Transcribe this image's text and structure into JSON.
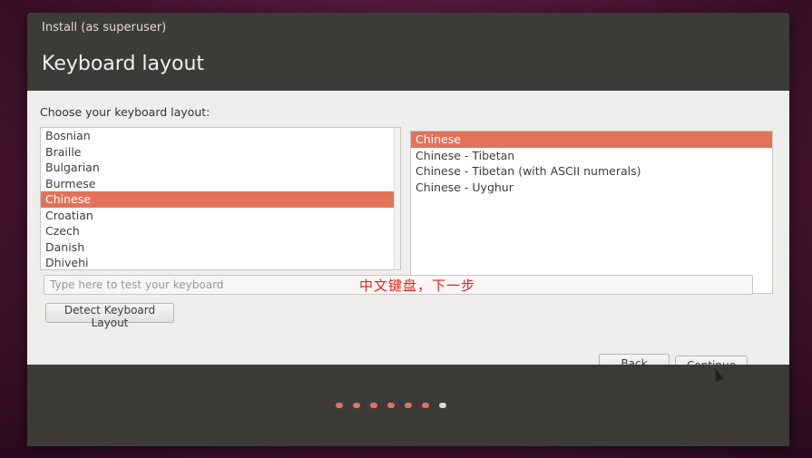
{
  "window": {
    "title": "Install (as superuser)",
    "heading": "Keyboard layout"
  },
  "main": {
    "prompt": "Choose your keyboard layout:",
    "layouts": [
      {
        "label": "Bosnian",
        "selected": false
      },
      {
        "label": "Braille",
        "selected": false
      },
      {
        "label": "Bulgarian",
        "selected": false
      },
      {
        "label": "Burmese",
        "selected": false
      },
      {
        "label": "Chinese",
        "selected": true
      },
      {
        "label": "Croatian",
        "selected": false
      },
      {
        "label": "Czech",
        "selected": false
      },
      {
        "label": "Danish",
        "selected": false
      },
      {
        "label": "Dhivehi",
        "selected": false
      }
    ],
    "variants": [
      {
        "label": "Chinese",
        "selected": true
      },
      {
        "label": "Chinese - Tibetan",
        "selected": false
      },
      {
        "label": "Chinese - Tibetan (with ASCII numerals)",
        "selected": false
      },
      {
        "label": "Chinese - Uyghur",
        "selected": false
      }
    ],
    "test_placeholder": "Type here to test your keyboard",
    "overlay_annotation": "中文键盘，下一步",
    "detect_button": "Detect Keyboard Layout"
  },
  "nav": {
    "back_label": "Back",
    "continue_label": "Continue"
  },
  "progress": {
    "total_steps": 7,
    "current_step": 7
  },
  "colors": {
    "accent": "#e2735a",
    "window_dark": "#3c3b37",
    "content_bg": "#efeeec"
  }
}
